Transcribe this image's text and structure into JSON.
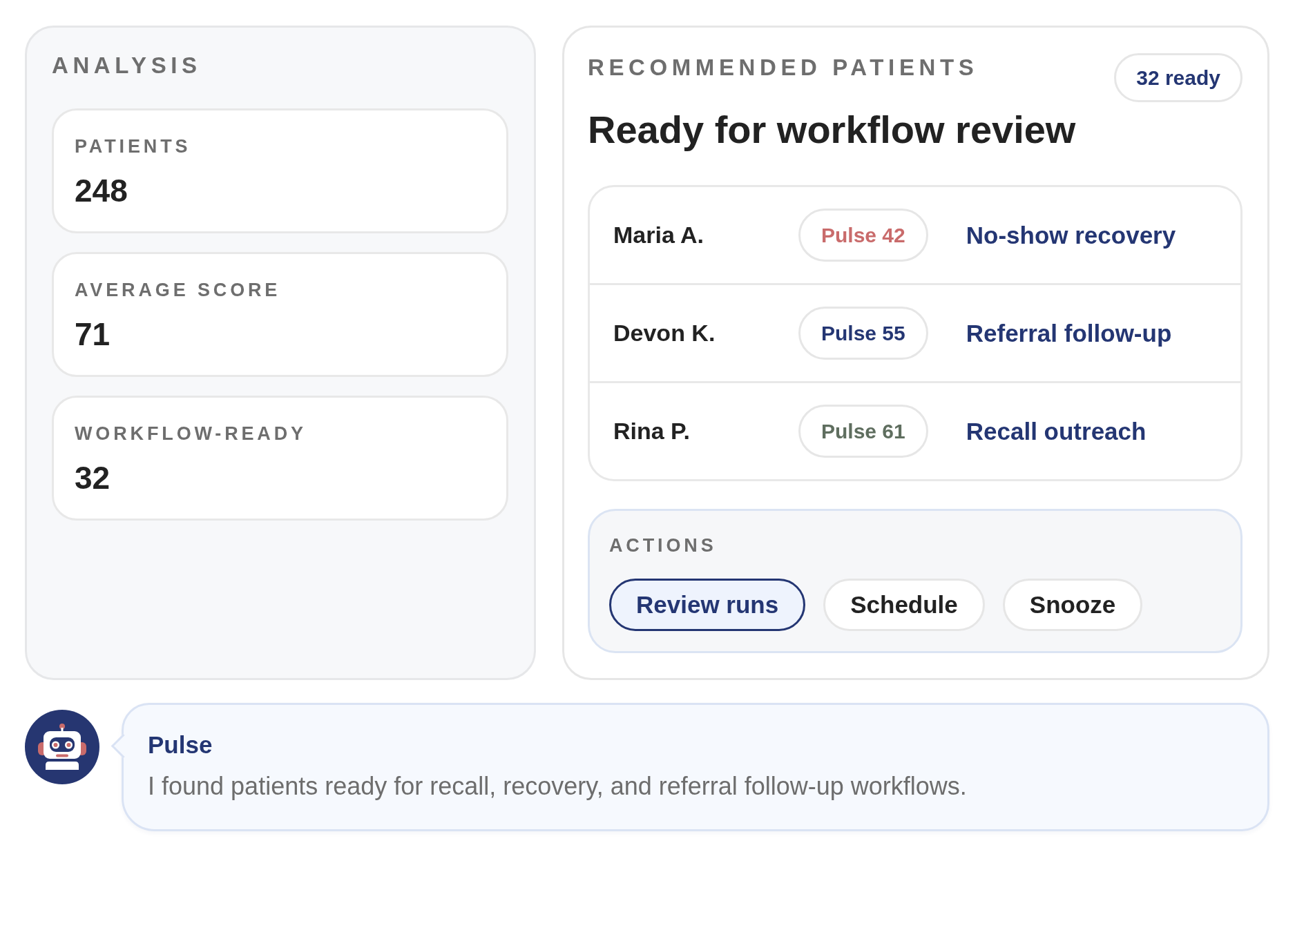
{
  "analysis": {
    "title": "ANALYSIS",
    "stats": [
      {
        "label": "PATIENTS",
        "value": "248"
      },
      {
        "label": "AVERAGE SCORE",
        "value": "71"
      },
      {
        "label": "WORKFLOW-READY",
        "value": "32"
      }
    ]
  },
  "recommended": {
    "eyebrow": "RECOMMENDED PATIENTS",
    "badge": "32 ready",
    "title": "Ready for workflow review",
    "patients": [
      {
        "name": "Maria A.",
        "score": "Pulse 42",
        "color": "#c96b6b",
        "workflow": "No-show recovery"
      },
      {
        "name": "Devon K.",
        "score": "Pulse 55",
        "color": "#243673",
        "workflow": "Referral follow-up"
      },
      {
        "name": "Rina P.",
        "score": "Pulse 61",
        "color": "#5f6e5f",
        "workflow": "Recall outreach"
      }
    ],
    "actions": {
      "title": "ACTIONS",
      "buttons": [
        {
          "label": "Review runs",
          "selected": true
        },
        {
          "label": "Schedule",
          "selected": false
        },
        {
          "label": "Snooze",
          "selected": false
        }
      ]
    }
  },
  "assistant_message": {
    "sender": "Pulse",
    "text": "I found patients ready for recall, recovery, and referral follow-up workflows."
  }
}
